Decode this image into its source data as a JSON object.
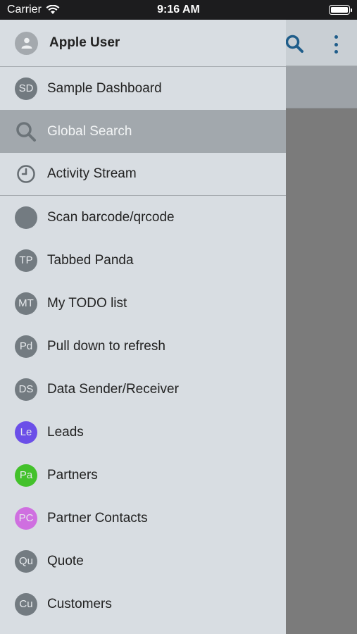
{
  "status_bar": {
    "carrier": "Carrier",
    "time": "9:16 AM"
  },
  "drawer": {
    "user_name": "Apple User",
    "top_items": [
      {
        "avatar": "SD",
        "label": "Sample Dashboard"
      },
      {
        "icon": "search-icon",
        "label": "Global Search",
        "selected": true
      },
      {
        "icon": "clock-icon",
        "label": "Activity Stream"
      }
    ],
    "items": [
      {
        "avatar": "",
        "label": "Scan barcode/qrcode",
        "color": "#737b81"
      },
      {
        "avatar": "TP",
        "label": "Tabbed Panda",
        "color": "#737b81"
      },
      {
        "avatar": "MT",
        "label": "My TODO list",
        "color": "#737b81"
      },
      {
        "avatar": "Pd",
        "label": "Pull down to refresh",
        "color": "#737b81"
      },
      {
        "avatar": "DS",
        "label": "Data Sender/Receiver",
        "color": "#737b81"
      },
      {
        "avatar": "Le",
        "label": "Leads",
        "color": "#6b4fe8"
      },
      {
        "avatar": "Pa",
        "label": "Partners",
        "color": "#43c12b"
      },
      {
        "avatar": "PC",
        "label": "Partner Contacts",
        "color": "#cf6fe0"
      },
      {
        "avatar": "Qu",
        "label": "Quote",
        "color": "#737b81"
      },
      {
        "avatar": "Cu",
        "label": "Customers",
        "color": "#737b81"
      }
    ]
  }
}
